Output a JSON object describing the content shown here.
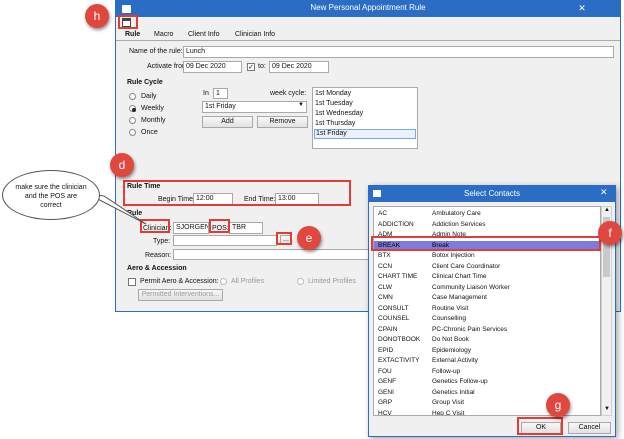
{
  "main": {
    "title": "New Personal Appointment Rule",
    "tabs": [
      "Rule",
      "Macro",
      "Client Info",
      "Clinician Info"
    ],
    "name_label": "Name of the rule:",
    "name_value": "Lunch",
    "activate_label": "Activate from:",
    "from_date": "09 Dec 2020",
    "to_label": "to:",
    "to_date": "09 Dec 2020",
    "cycle_title": "Rule Cycle",
    "cycle_options": [
      "Daily",
      "Weekly",
      "Monthly",
      "Once"
    ],
    "in_label": "In",
    "in_value": "1",
    "week_cycle_label": "week cycle:",
    "select_value": "1st Friday",
    "add_label": "Add",
    "remove_label": "Remove",
    "cycle_list": [
      "1st Monday",
      "1st Tuesday",
      "1st Wednesday",
      "1st Thursday",
      "1st Friday"
    ],
    "time_title": "Rule Time",
    "begin_label": "Begin Time:",
    "begin_value": "12:00",
    "end_label": "End Time:",
    "end_value": "13:00",
    "rule_title": "Rule",
    "clinician_label": "Clinician:",
    "clinician_value": "SJORGEN",
    "pos_label": "POS:",
    "pos_value": "TBR",
    "type_label": "Type:",
    "reason_label": "Reason:",
    "aero_title": "Aero & Accession",
    "permit_label": "Permit Aero & Accession:",
    "all_profiles": "All Profiles",
    "limited_profiles": "Limited Profiles",
    "permitted_btn": "Permitted Interventions...",
    "browse_btn": "..."
  },
  "dialog": {
    "title": "Select Contacts",
    "close": "✕",
    "items": [
      {
        "code": "AC",
        "name": "Ambulatory Care"
      },
      {
        "code": "ADDICTION",
        "name": "Addiction Services"
      },
      {
        "code": "ADM",
        "name": "Admin Note"
      },
      {
        "code": "BREAK",
        "name": "Break"
      },
      {
        "code": "BTX",
        "name": "Botox Injection"
      },
      {
        "code": "CCN",
        "name": "Client Care Coordinator"
      },
      {
        "code": "CHART TIME",
        "name": "Clinical Chart Time"
      },
      {
        "code": "CLW",
        "name": "Community Liaison Worker"
      },
      {
        "code": "CMN",
        "name": "Case Management"
      },
      {
        "code": "CONSULT",
        "name": "Routine Visit"
      },
      {
        "code": "COUNSEL",
        "name": "Counselling"
      },
      {
        "code": "CPAIN",
        "name": "PC-Chronic Pain Services"
      },
      {
        "code": "DONOTBOOK",
        "name": "Do Not Book"
      },
      {
        "code": "EPID",
        "name": "Epidemiology"
      },
      {
        "code": "EXTACTIVITY",
        "name": "External Activity"
      },
      {
        "code": "FOU",
        "name": "Follow-up"
      },
      {
        "code": "GENF",
        "name": "Genetics Follow-up"
      },
      {
        "code": "GENI",
        "name": "Genetics Initial"
      },
      {
        "code": "GRP",
        "name": "Group Visit"
      },
      {
        "code": "HCV",
        "name": "Hep C Visit"
      }
    ],
    "ok_label": "OK",
    "cancel_label": "Cancel"
  },
  "annotations": {
    "h": "h",
    "d": "d",
    "e": "e",
    "f": "f",
    "g": "g",
    "callout": "make sure the clinician and the POS are correct"
  },
  "colors": {
    "titlebar": "#2b6cc4",
    "marker": "#e0473f",
    "highlight_box": "#e43b35",
    "selected_row": "#7b7be0"
  }
}
